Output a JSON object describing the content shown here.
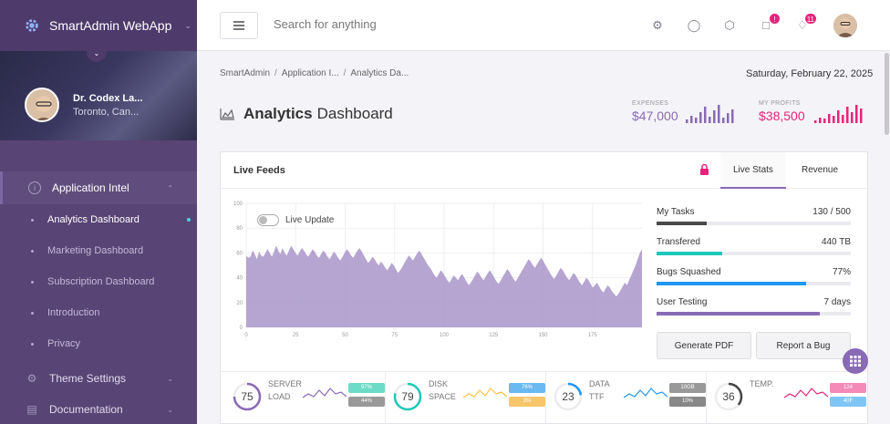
{
  "brand": {
    "name": "SmartAdmin WebApp"
  },
  "user": {
    "name": "Dr. Codex La...",
    "location": "Toronto, Can..."
  },
  "nav": {
    "section": "Application Intel",
    "items": [
      {
        "label": "Analytics Dashboard",
        "active": true
      },
      {
        "label": "Marketing Dashboard"
      },
      {
        "label": "Subscription Dashboard"
      },
      {
        "label": "Introduction"
      },
      {
        "label": "Privacy"
      }
    ],
    "theme": "Theme Settings",
    "docs": "Documentation"
  },
  "header": {
    "search_placeholder": "Search for anything",
    "notifications_badge": "11",
    "messages_badge": "!"
  },
  "breadcrumb": [
    "SmartAdmin",
    "Application I...",
    "Analytics Da..."
  ],
  "date": "Saturday, February 22, 2025",
  "page": {
    "title_bold": "Analytics",
    "title_rest": "Dashboard"
  },
  "kpis": {
    "expenses": {
      "label": "EXPENSES",
      "value": "$47,000",
      "color": "#886ab5"
    },
    "profits": {
      "label": "MY PROFITS",
      "value": "$38,500",
      "color": "#e7237b"
    }
  },
  "panel": {
    "title": "Live Feeds",
    "tabs": [
      "Live Stats",
      "Revenue"
    ],
    "toggle_label": "Live Update",
    "stats": [
      {
        "label": "My Tasks",
        "value": "130 / 500",
        "fraction": 0.26,
        "color": "#4a4a4a"
      },
      {
        "label": "Transfered",
        "value": "440 TB",
        "fraction": 0.34,
        "color": "#1dc9b7"
      },
      {
        "label": "Bugs Squashed",
        "value": "77%",
        "fraction": 0.77,
        "color": "#2196f3"
      },
      {
        "label": "User Testing",
        "value": "7 days",
        "fraction": 0.84,
        "color": "#886ab5"
      }
    ],
    "buttons": [
      "Generate PDF",
      "Report a Bug"
    ]
  },
  "chart_data": {
    "type": "area",
    "ylim": [
      0,
      100
    ],
    "yticks": [
      0,
      20,
      40,
      60,
      80,
      100
    ],
    "xticks": [
      0,
      25,
      50,
      75,
      100,
      125,
      150,
      175
    ],
    "xlim": [
      0,
      200
    ],
    "color": "#a995c9",
    "values": [
      58,
      56,
      57,
      62,
      59,
      55,
      61,
      58,
      57,
      60,
      63,
      60,
      57,
      61,
      66,
      62,
      59,
      64,
      60,
      58,
      62,
      66,
      63,
      60,
      58,
      61,
      64,
      62,
      59,
      57,
      60,
      63,
      61,
      58,
      56,
      59,
      62,
      60,
      57,
      55,
      58,
      61,
      59,
      56,
      54,
      57,
      60,
      63,
      61,
      58,
      56,
      59,
      62,
      64,
      61,
      58,
      55,
      52,
      54,
      57,
      55,
      52,
      50,
      53,
      51,
      48,
      46,
      49,
      52,
      50,
      47,
      44,
      46,
      49,
      52,
      55,
      58,
      56,
      54,
      57,
      60,
      62,
      59,
      56,
      53,
      50,
      48,
      45,
      42,
      40,
      43,
      46,
      44,
      41,
      38,
      36,
      39,
      42,
      40,
      38,
      41,
      43,
      40,
      37,
      34,
      36,
      39,
      42,
      45,
      43,
      40,
      38,
      41,
      44,
      46,
      43,
      40,
      37,
      35,
      38,
      41,
      44,
      47,
      45,
      42,
      39,
      37,
      40,
      43,
      46,
      49,
      52,
      55,
      53,
      50,
      48,
      51,
      54,
      56,
      53,
      50,
      47,
      44,
      41,
      39,
      42,
      45,
      48,
      46,
      43,
      40,
      38,
      41,
      44,
      42,
      39,
      36,
      34,
      37,
      40,
      38,
      35,
      32,
      34,
      36,
      33,
      30,
      28,
      31,
      34,
      32,
      29,
      27,
      25,
      27,
      30,
      33,
      36,
      34,
      38,
      42,
      46,
      50,
      55,
      60,
      63
    ]
  },
  "gauges": [
    {
      "value": "75",
      "label1": "SERVER",
      "label2": "LOAD",
      "color": "#886ab5",
      "pct": 0.75,
      "pill1": "97%",
      "pill2": "44%",
      "pill1_color": "#6cdcc8",
      "pill2_color": "#999999",
      "spark_color": "#886ab5"
    },
    {
      "value": "79",
      "label1": "DISK",
      "label2": "SPACE",
      "color": "#1dc9b7",
      "pct": 0.79,
      "pill1": "76%",
      "pill2": "3%",
      "pill1_color": "#6ab9f0",
      "pill2_color": "#f5c76a",
      "spark_color": "#ffc241"
    },
    {
      "value": "23",
      "label1": "DATA",
      "label2": "TTF",
      "color": "#2196f3",
      "pct": 0.23,
      "pill1": "10GB",
      "pill2": "10%",
      "pill1_color": "#999999",
      "pill2_color": "#888888",
      "spark_color": "#2196f3"
    },
    {
      "value": "36",
      "label1": "TEMP.",
      "label2": "",
      "color": "#444444",
      "pct": 0.36,
      "pill1": "124",
      "pill2": "40F",
      "pill1_color": "#f48ab8",
      "pill2_color": "#7fc6f5",
      "spark_color": "#e7237b"
    }
  ]
}
